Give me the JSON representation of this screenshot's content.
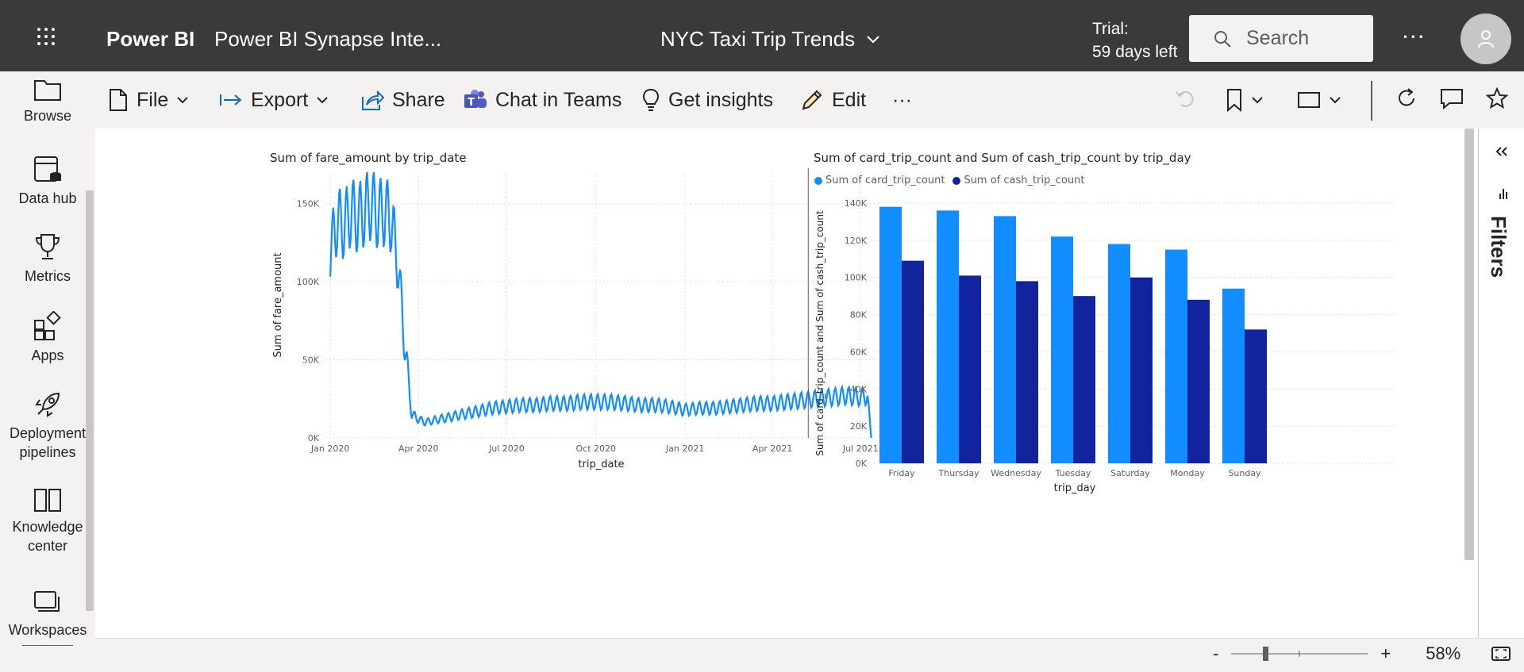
{
  "topbar": {
    "brand": "Power BI",
    "workspace": "Power BI Synapse Inte...",
    "report_title": "NYC Taxi Trip Trends",
    "trial_line1": "Trial:",
    "trial_line2": "59 days left",
    "search_placeholder": "Search",
    "more": "···"
  },
  "sidebar": {
    "items": [
      {
        "label": "Browse",
        "icon": "folder-icon"
      },
      {
        "label": "Data hub",
        "icon": "data-hub-icon"
      },
      {
        "label": "Metrics",
        "icon": "trophy-icon"
      },
      {
        "label": "Apps",
        "icon": "apps-icon"
      },
      {
        "label": "Deployment pipelines",
        "line1": "Deployment",
        "line2": "pipelines",
        "icon": "rocket-icon"
      },
      {
        "label": "Knowledge center",
        "line1": "Knowledge",
        "line2": "center",
        "icon": "book-icon"
      },
      {
        "label": "Workspaces",
        "icon": "workspaces-icon"
      }
    ]
  },
  "toolbar": {
    "file": "File",
    "export": "Export",
    "share": "Share",
    "chat": "Chat in Teams",
    "insights": "Get insights",
    "edit": "Edit",
    "more": "···"
  },
  "filters_label": "Filters",
  "footer": {
    "zoom_minus": "-",
    "zoom_plus": "+",
    "zoom_level": "58%"
  },
  "colors": {
    "card": "#118dff",
    "cash": "#12239e",
    "line": "#118dff"
  },
  "chart_data": [
    {
      "type": "line",
      "title": "Sum of fare_amount by trip_date",
      "xlabel": "trip_date",
      "ylabel": "Sum of fare_amount",
      "x_ticks": [
        "Jan 2020",
        "Apr 2020",
        "Jul 2020",
        "Oct 2020",
        "Jan 2021",
        "Apr 2021",
        "Jul 2021"
      ],
      "y_ticks": [
        "0K",
        "50K",
        "100K",
        "150K"
      ],
      "ylim": [
        0,
        170000
      ],
      "series": [
        {
          "values_weekly": [
            {
              "x": "2020-01-01",
              "y": 118000
            },
            {
              "x": "2020-01-08",
              "y": 140000
            },
            {
              "x": "2020-01-15",
              "y": 135000
            },
            {
              "x": "2020-01-22",
              "y": 145000
            },
            {
              "x": "2020-01-29",
              "y": 140000
            },
            {
              "x": "2020-02-05",
              "y": 145000
            },
            {
              "x": "2020-02-12",
              "y": 150000
            },
            {
              "x": "2020-02-19",
              "y": 143000
            },
            {
              "x": "2020-02-26",
              "y": 145000
            },
            {
              "x": "2020-03-04",
              "y": 140000
            },
            {
              "x": "2020-03-11",
              "y": 110000
            },
            {
              "x": "2020-03-18",
              "y": 60000
            },
            {
              "x": "2020-03-25",
              "y": 15000
            },
            {
              "x": "2020-04-01",
              "y": 12000
            },
            {
              "x": "2020-04-08",
              "y": 10000
            },
            {
              "x": "2020-04-15",
              "y": 11000
            },
            {
              "x": "2020-04-22",
              "y": 12000
            },
            {
              "x": "2020-05-01",
              "y": 13000
            },
            {
              "x": "2020-05-15",
              "y": 15000
            },
            {
              "x": "2020-06-01",
              "y": 17000
            },
            {
              "x": "2020-06-15",
              "y": 19000
            },
            {
              "x": "2020-07-01",
              "y": 20000
            },
            {
              "x": "2020-07-15",
              "y": 21000
            },
            {
              "x": "2020-08-01",
              "y": 21000
            },
            {
              "x": "2020-08-15",
              "y": 22000
            },
            {
              "x": "2020-09-01",
              "y": 22000
            },
            {
              "x": "2020-09-15",
              "y": 23000
            },
            {
              "x": "2020-10-01",
              "y": 23000
            },
            {
              "x": "2020-10-15",
              "y": 23000
            },
            {
              "x": "2020-11-01",
              "y": 22000
            },
            {
              "x": "2020-11-15",
              "y": 21000
            },
            {
              "x": "2020-12-01",
              "y": 21000
            },
            {
              "x": "2020-12-15",
              "y": 20000
            },
            {
              "x": "2021-01-01",
              "y": 18000
            },
            {
              "x": "2021-01-15",
              "y": 19000
            },
            {
              "x": "2021-02-01",
              "y": 19000
            },
            {
              "x": "2021-02-15",
              "y": 20000
            },
            {
              "x": "2021-03-01",
              "y": 21000
            },
            {
              "x": "2021-03-15",
              "y": 22000
            },
            {
              "x": "2021-04-01",
              "y": 22000
            },
            {
              "x": "2021-04-15",
              "y": 23000
            },
            {
              "x": "2021-05-01",
              "y": 24000
            },
            {
              "x": "2021-05-15",
              "y": 25000
            },
            {
              "x": "2021-06-01",
              "y": 26000
            },
            {
              "x": "2021-06-15",
              "y": 27000
            },
            {
              "x": "2021-07-01",
              "y": 26000
            },
            {
              "x": "2021-07-08",
              "y": 27000
            },
            {
              "x": "2021-07-12",
              "y": 0
            }
          ]
        }
      ]
    },
    {
      "type": "bar",
      "title": "Sum of card_trip_count and Sum of cash_trip_count by trip_day",
      "xlabel": "trip_day",
      "ylabel": "Sum of card_trip_count and Sum of cash_trip_count",
      "categories": [
        "Friday",
        "Thursday",
        "Wednesday",
        "Tuesday",
        "Saturday",
        "Monday",
        "Sunday"
      ],
      "y_ticks": [
        "0K",
        "20K",
        "40K",
        "60K",
        "80K",
        "100K",
        "120K",
        "140K"
      ],
      "ylim": [
        0,
        140000
      ],
      "legend_position": "top-left",
      "series": [
        {
          "name": "Sum of card_trip_count",
          "values": [
            138000,
            136000,
            133000,
            122000,
            118000,
            115000,
            94000
          ]
        },
        {
          "name": "Sum of cash_trip_count",
          "values": [
            109000,
            101000,
            98000,
            90000,
            100000,
            88000,
            72000
          ]
        }
      ]
    }
  ]
}
